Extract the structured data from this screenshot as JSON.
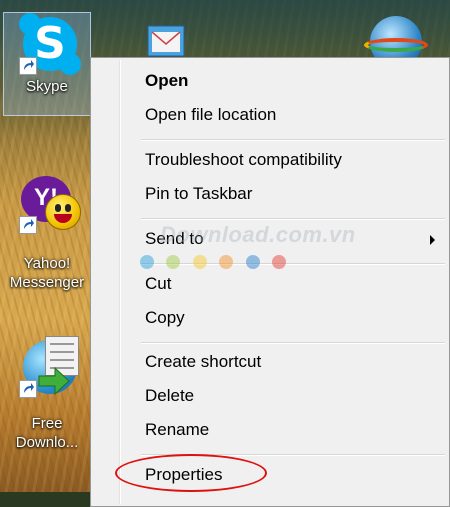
{
  "desktop": {
    "icons": [
      {
        "label": "Skype",
        "icon": "skype-icon"
      },
      {
        "label": "Yahoo! Messenger",
        "icon": "yahoo-messenger-icon"
      },
      {
        "label": "Free Downlo...",
        "icon": "free-download-manager-icon"
      }
    ]
  },
  "context_menu": {
    "items": [
      {
        "label": "Open",
        "bold": true
      },
      {
        "label": "Open file location"
      },
      {
        "label": "Troubleshoot compatibility"
      },
      {
        "label": "Pin to Taskbar"
      },
      {
        "label": "Send to",
        "submenu": true
      },
      {
        "label": "Cut"
      },
      {
        "label": "Copy"
      },
      {
        "label": "Create shortcut"
      },
      {
        "label": "Delete"
      },
      {
        "label": "Rename"
      },
      {
        "label": "Properties"
      }
    ]
  },
  "watermark": {
    "text": "Download.com.vn",
    "dot_colors": [
      "#1f9bd7",
      "#9bc93c",
      "#f7c51e",
      "#f08c1c",
      "#1f77c9",
      "#e5332a"
    ]
  },
  "colors": {
    "menu_background": "#f0f0f0",
    "highlight_ring": "#e01010"
  }
}
